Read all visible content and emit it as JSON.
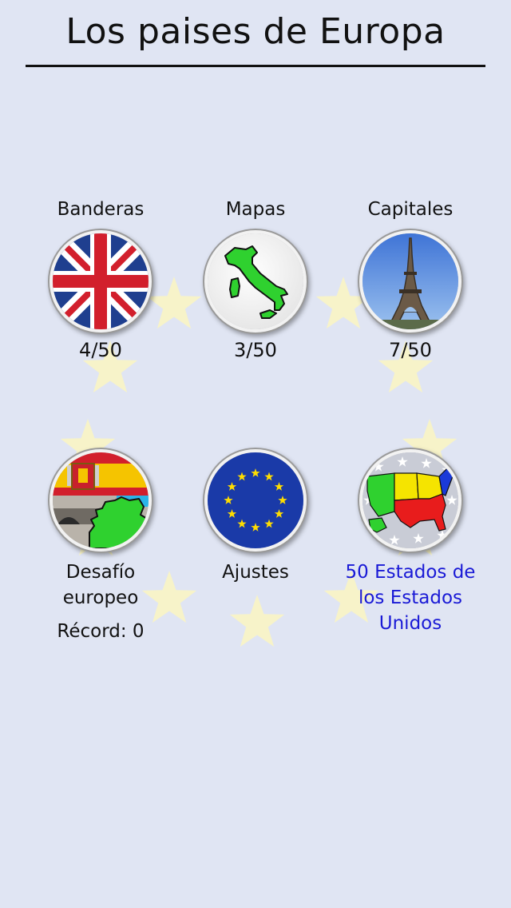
{
  "header": {
    "title": "Los paises de Europa"
  },
  "tiles": {
    "flags": {
      "label": "Banderas",
      "score": "4/50",
      "icon": "uk-flag-icon"
    },
    "maps": {
      "label": "Mapas",
      "score": "3/50",
      "icon": "italy-map-icon"
    },
    "capitals": {
      "label": "Capitales",
      "score": "7/50",
      "icon": "eiffel-tower-icon"
    },
    "challenge": {
      "label_line1": "Desafío",
      "label_line2": "europeo",
      "record": "Récord: 0",
      "icon": "spain-challenge-icon"
    },
    "settings": {
      "label": "Ajustes",
      "icon": "eu-flag-icon"
    },
    "usa": {
      "label_line1": "50 Estados de",
      "label_line2": "los Estados Unidos",
      "icon": "usa-map-icon",
      "color": "#1a1ad6"
    }
  },
  "colors": {
    "background": "#e0e5f3",
    "star": "#f7f3c9",
    "link": "#1a1ad6"
  }
}
